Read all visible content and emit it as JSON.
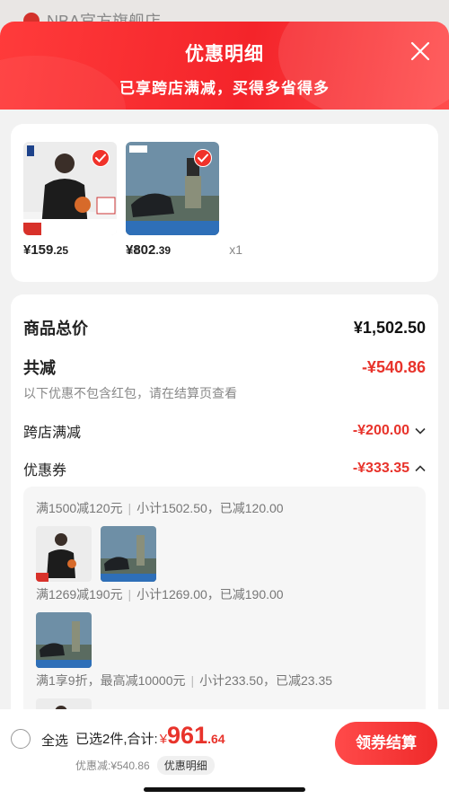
{
  "background": {
    "store_name": "NBA官方旗舰店"
  },
  "header": {
    "title": "优惠明细",
    "subtitle": "已享跨店满减，买得多省得多"
  },
  "products": [
    {
      "price_main": "¥159",
      "price_cents": ".25",
      "qty": "x1"
    },
    {
      "price_main": "¥802",
      "price_cents": ".39",
      "qty": "x1"
    }
  ],
  "detail": {
    "total_label": "商品总价",
    "total_value": "¥1,502.50",
    "reduce_label": "共减",
    "reduce_value": "-¥540.86",
    "note": "以下优惠不包含红包，请在结算页查看",
    "cross_store_label": "跨店满减",
    "cross_store_value": "-¥200.00",
    "coupon_label": "优惠券",
    "coupon_value": "-¥333.35"
  },
  "coupons": [
    {
      "rule": "满1500减120元",
      "summary": "小计1502.50，已减120.00"
    },
    {
      "rule": "满1269减190元",
      "summary": "小计1269.00，已减190.00"
    },
    {
      "rule": "满1享9折，最高减10000元",
      "summary": "小计233.50，已减23.35"
    }
  ],
  "bottom": {
    "select_all": "全选",
    "selected_text": "已选2件,合计:",
    "currency": "¥",
    "total_main": "961",
    "total_cents": ".64",
    "saved_text": "优惠减:¥540.86",
    "detail_pill": "优惠明细",
    "checkout": "领券结算"
  },
  "colors": {
    "accent": "#f0322a",
    "header_gradient_start": "#ff3b3b",
    "header_gradient_end": "#ff4d4d"
  }
}
